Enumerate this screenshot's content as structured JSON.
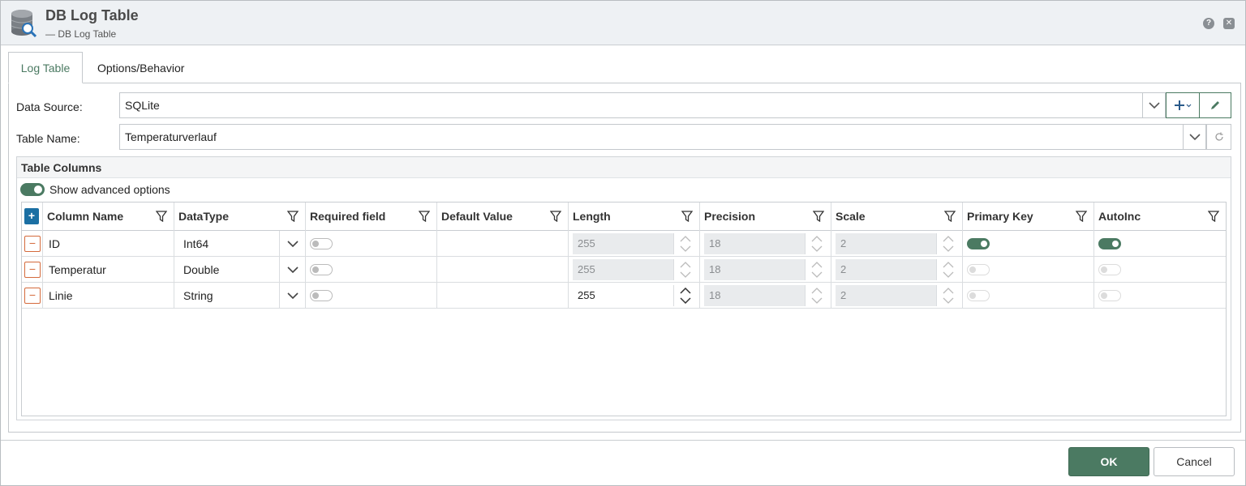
{
  "window": {
    "title": "DB Log Table",
    "subtitle": "— DB Log Table",
    "help_icon": "?",
    "close_icon": "✕"
  },
  "tabs": [
    {
      "label": "Log Table",
      "active": true
    },
    {
      "label": "Options/Behavior",
      "active": false
    }
  ],
  "form": {
    "data_source_label": "Data Source:",
    "data_source_value": "SQLite",
    "table_name_label": "Table Name:",
    "table_name_value": "Temperaturverlauf"
  },
  "table_columns": {
    "title": "Table Columns",
    "show_advanced_label": "Show advanced options",
    "show_advanced_on": true,
    "add_icon": "+",
    "delete_icon": "−",
    "headers": [
      "Column Name",
      "DataType",
      "Required field",
      "Default Value",
      "Length",
      "Precision",
      "Scale",
      "Primary Key",
      "AutoInc"
    ],
    "rows": [
      {
        "name": "ID",
        "datatype": "Int64",
        "required": false,
        "default": "",
        "length": "255",
        "length_enabled": false,
        "precision": "18",
        "scale": "2",
        "primary_key": true,
        "autoinc": true
      },
      {
        "name": "Temperatur",
        "datatype": "Double",
        "required": false,
        "default": "",
        "length": "255",
        "length_enabled": false,
        "precision": "18",
        "scale": "2",
        "primary_key": false,
        "autoinc": false
      },
      {
        "name": "Linie",
        "datatype": "String",
        "required": false,
        "default": "",
        "length": "255",
        "length_enabled": true,
        "precision": "18",
        "scale": "2",
        "primary_key": false,
        "autoinc": false
      }
    ]
  },
  "buttons": {
    "ok": "OK",
    "cancel": "Cancel"
  },
  "colors": {
    "accent": "#4b7a62",
    "add_button": "#1b6fa3",
    "delete_button": "#d46a3c"
  }
}
